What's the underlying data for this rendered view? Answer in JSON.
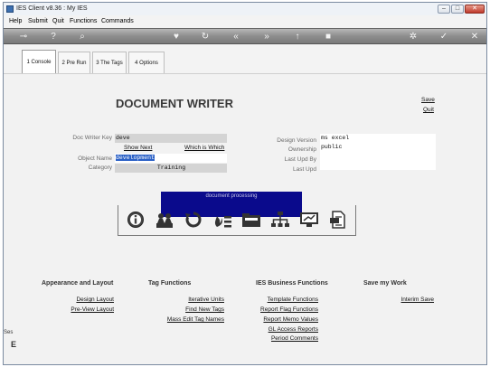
{
  "window": {
    "title": "IES Client v8.36 : My IES"
  },
  "menu": [
    "Help",
    "Submit",
    "Quit",
    "Functions",
    "Commands"
  ],
  "tabs": [
    {
      "label": "1 Console",
      "active": true
    },
    {
      "label": "2 Pre Run",
      "active": false
    },
    {
      "label": "3 The Tags",
      "active": false
    },
    {
      "label": "4 Options",
      "active": false
    }
  ],
  "page": {
    "title": "DOCUMENT WRITER",
    "save_label": "Save",
    "quit_label": "Quit"
  },
  "form": {
    "doc_writer_key_label": "Doc Writer Key",
    "doc_writer_key_value": "deve",
    "show_next_label": "Show Next",
    "which_is_which_label": "Which is Which",
    "object_name_label": "Object Name",
    "object_name_value": "development",
    "category_label": "Category",
    "category_value": "Training",
    "design_version_label": "Design Version",
    "design_version_value": "ms excel",
    "ownership_label": "Ownership",
    "ownership_value": "public",
    "last_upd_by_label": "Last Upd By",
    "last_upd_by_value": "",
    "last_upd_label": "Last Upd",
    "last_upd_value": ""
  },
  "banner": {
    "text": "document processing"
  },
  "icons": [
    "info-icon",
    "people-icon",
    "refresh-icon",
    "fire-list-icon",
    "folder-icon",
    "hierarchy-icon",
    "monitor-icon",
    "document-icon"
  ],
  "sections": {
    "appearance": {
      "title": "Appearance and Layout",
      "links": [
        "Design Layout",
        "Pre-View Layout"
      ]
    },
    "tag_functions": {
      "title": "Tag Functions",
      "links": [
        "Iterative Units",
        "Find New Tags",
        "Mass Edit Tag Names"
      ]
    },
    "business": {
      "title": "IES Business Functions",
      "links": [
        "Template Functions",
        "Report Flag Functions",
        "Report Memo Values",
        "GL Access Reports",
        "Period Comments"
      ]
    },
    "save_work": {
      "title": "Save my Work",
      "links": [
        "Interim Save"
      ]
    }
  },
  "sidebar_clip": {
    "line1": "Ses",
    "line2": "E"
  }
}
